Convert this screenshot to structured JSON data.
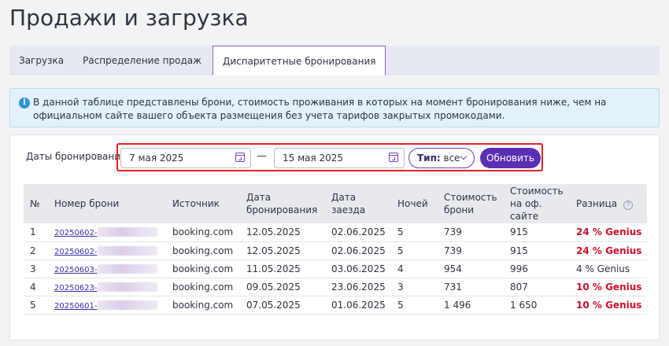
{
  "page_title": "Продажи и загрузка",
  "tabs": [
    {
      "label": "Загрузка",
      "active": false
    },
    {
      "label": "Распределение продаж",
      "active": false
    },
    {
      "label": "Диспаритетные бронирования",
      "active": true
    }
  ],
  "info": {
    "icon": "info-icon",
    "text": "В данной таблице представлены брони, стоимость проживания в которых на момент бронирования ниже, чем на официальном сайте вашего объекта размещения без учета тарифов закрытых промокодами."
  },
  "filters": {
    "label": "Даты бронирования",
    "date_from": "7 мая 2025",
    "separator": "—",
    "date_to": "15 мая 2025",
    "type_label": "Тип:",
    "type_value": "все",
    "refresh_label": "Обновить"
  },
  "table": {
    "headers": {
      "num": "№",
      "booking": "Номер брони",
      "source": "Источник",
      "booking_date": "Дата бронирования",
      "checkin": "Дата заезда",
      "nights": "Ночей",
      "price": "Стоимость брони",
      "site_price": "Стоимость на оф. сайте",
      "diff": "Разница",
      "help_icon": "?"
    },
    "rows": [
      {
        "num": "1",
        "booking": "20250602-",
        "source": "booking.com",
        "booking_date": "12.05.2025",
        "checkin": "02.06.2025",
        "nights": "5",
        "price": "739",
        "site_price": "915",
        "diff": "24 %  Genius",
        "highlight": true
      },
      {
        "num": "2",
        "booking": "20250602-",
        "source": "booking.com",
        "booking_date": "12.05.2025",
        "checkin": "02.06.2025",
        "nights": "5",
        "price": "739",
        "site_price": "915",
        "diff": "24 %  Genius",
        "highlight": true
      },
      {
        "num": "3",
        "booking": "20250603-",
        "source": "booking.com",
        "booking_date": "11.05.2025",
        "checkin": "03.06.2025",
        "nights": "4",
        "price": "954",
        "site_price": "996",
        "diff": "4 %  Genius",
        "highlight": false
      },
      {
        "num": "4",
        "booking": "20250623-",
        "source": "booking.com",
        "booking_date": "09.05.2025",
        "checkin": "23.06.2025",
        "nights": "3",
        "price": "731",
        "site_price": "807",
        "diff": "10 %  Genius",
        "highlight": true
      },
      {
        "num": "5",
        "booking": "20250601-",
        "source": "booking.com",
        "booking_date": "07.05.2025",
        "checkin": "01.06.2025",
        "nights": "5",
        "price": "1 496",
        "site_price": "1 650",
        "diff": "10 %  Genius",
        "highlight": true
      }
    ]
  }
}
